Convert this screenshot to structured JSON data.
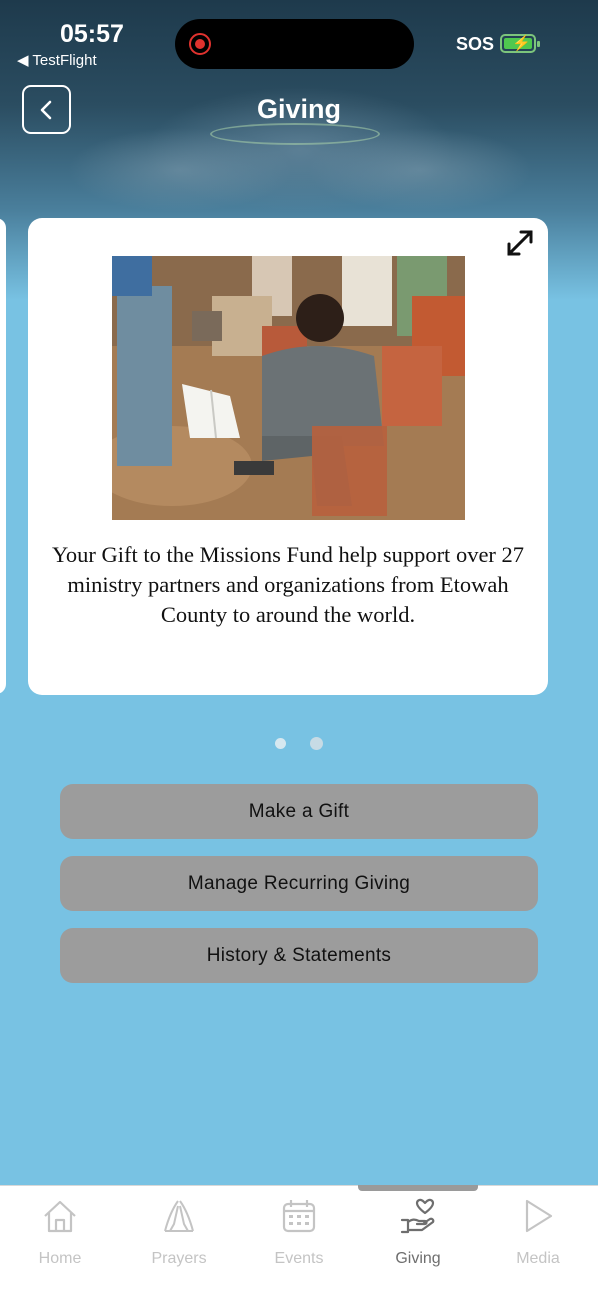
{
  "status_bar": {
    "time": "05:57",
    "back_app": "◀ TestFlight",
    "sos": "SOS"
  },
  "header": {
    "title": "Giving"
  },
  "carousel": {
    "caption": "Your Gift to the Missions Fund help support over 27 ministry partners and organizations from Etowah County to around the world.",
    "slide_count": 2,
    "active_slide": 1
  },
  "actions": {
    "make_gift": "Make a Gift",
    "manage_recurring": "Manage Recurring Giving",
    "history": "History & Statements"
  },
  "tabs": [
    {
      "label": "Home",
      "icon": "home-icon",
      "active": false
    },
    {
      "label": "Prayers",
      "icon": "praying-hands-icon",
      "active": false
    },
    {
      "label": "Events",
      "icon": "calendar-icon",
      "active": false
    },
    {
      "label": "Giving",
      "icon": "hand-heart-icon",
      "active": true
    },
    {
      "label": "Media",
      "icon": "play-icon",
      "active": false
    }
  ],
  "colors": {
    "background": "#78c2e3",
    "button": "#9c9c9c",
    "recording": "#e0322e",
    "battery": "#4fc84f"
  }
}
